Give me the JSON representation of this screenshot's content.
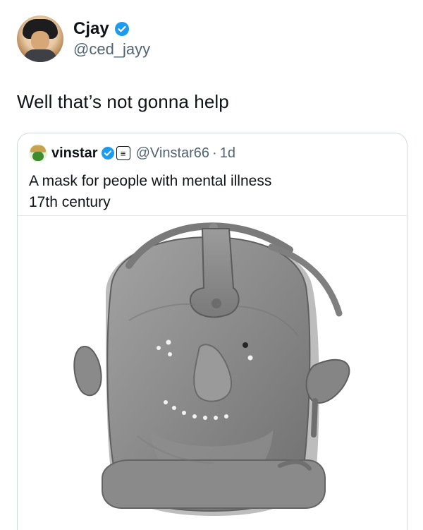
{
  "post": {
    "author": {
      "display_name": "Cjay",
      "handle": "@ced_jayy",
      "verified": true,
      "avatar_icon": "user-avatar-illustration"
    },
    "text": "Well that’s not gonna help"
  },
  "quote": {
    "author": {
      "display_name": "vinstar",
      "handle": "@Vinstar66",
      "verified": true,
      "org_badge_icon": "news-badge-icon"
    },
    "separator": "·",
    "time": "1d",
    "text_line1": "A mask for people with mental illness",
    "text_line2": "17th century",
    "media_icon": "iron-mask-photo"
  },
  "colors": {
    "text_primary": "#0f1419",
    "text_secondary": "#536471",
    "verified_blue": "#1d9bf0",
    "card_border": "#cfd9de",
    "mask_metal": "#8f8f8f"
  }
}
